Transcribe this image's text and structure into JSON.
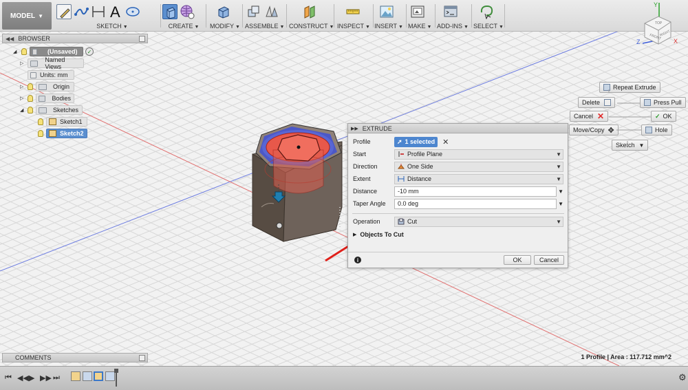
{
  "toolbar": {
    "model": "MODEL",
    "groups": [
      {
        "label": "SKETCH"
      },
      {
        "label": "CREATE"
      },
      {
        "label": "MODIFY"
      },
      {
        "label": "ASSEMBLE"
      },
      {
        "label": "CONSTRUCT"
      },
      {
        "label": "INSPECT"
      },
      {
        "label": "INSERT"
      },
      {
        "label": "MAKE"
      },
      {
        "label": "ADD-INS"
      },
      {
        "label": "SELECT"
      }
    ]
  },
  "browser": {
    "title": "BROWSER",
    "items": [
      {
        "label": "(Unsaved)"
      },
      {
        "label": "Named Views"
      },
      {
        "label": "Units: mm"
      },
      {
        "label": "Origin"
      },
      {
        "label": "Bodies"
      },
      {
        "label": "Sketches"
      },
      {
        "label": "Sketch1"
      },
      {
        "label": "Sketch2"
      }
    ]
  },
  "comments": {
    "title": "COMMENTS"
  },
  "extrude": {
    "title": "EXTRUDE",
    "rows": {
      "profile": {
        "label": "Profile",
        "value": "1 selected"
      },
      "start": {
        "label": "Start",
        "value": "Profile Plane"
      },
      "direction": {
        "label": "Direction",
        "value": "One Side"
      },
      "extent": {
        "label": "Extent",
        "value": "Distance"
      },
      "distance": {
        "label": "Distance",
        "value": "-10 mm"
      },
      "taper": {
        "label": "Taper Angle",
        "value": "0.0 deg"
      },
      "operation": {
        "label": "Operation",
        "value": "Cut"
      }
    },
    "objects_to_cut": "Objects To Cut",
    "ok": "OK",
    "cancel": "Cancel"
  },
  "marking_menu": {
    "repeat": "Repeat Extrude",
    "delete": "Delete",
    "press_pull": "Press Pull",
    "cancel": "Cancel",
    "ok": "OK",
    "move_copy": "Move/Copy",
    "hole": "Hole",
    "sketch": "Sketch"
  },
  "status": {
    "text": "1 Profile | Area : 117.712 mm^2"
  },
  "viewcube": {
    "front": "FRONT",
    "right": "RIGHT",
    "top": "TOP",
    "axis_x": "X",
    "axis_y": "Y",
    "axis_z": "Z"
  },
  "colors": {
    "accent": "#4d86cf",
    "cut_red": "#e8584a",
    "body": "#6e6258",
    "arrow": "#e0201a"
  }
}
